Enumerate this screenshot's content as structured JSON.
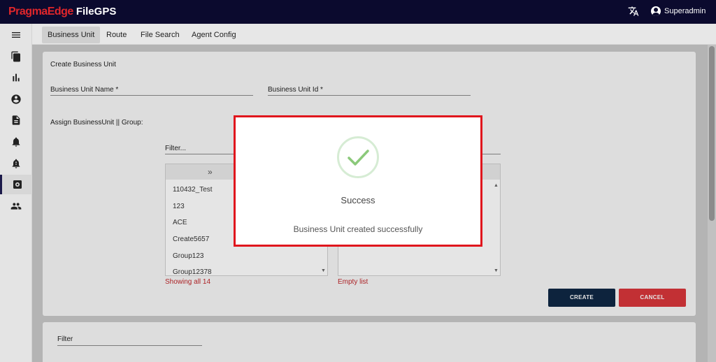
{
  "header": {
    "brand_name": "PragmaEdge",
    "product_name": "FileGPS",
    "language_icon": "translate-icon",
    "user_icon": "account-circle-icon",
    "user_name": "Superadmin"
  },
  "sidebar": {
    "items": [
      {
        "name": "menu-icon"
      },
      {
        "name": "files-icon"
      },
      {
        "name": "bar-chart-icon"
      },
      {
        "name": "account-icon"
      },
      {
        "name": "document-icon"
      },
      {
        "name": "notification-icon"
      },
      {
        "name": "alert-icon"
      },
      {
        "name": "settings-icon",
        "active": true
      },
      {
        "name": "group-icon"
      }
    ]
  },
  "tabs": [
    {
      "label": "Business Unit",
      "active": true
    },
    {
      "label": "Route"
    },
    {
      "label": "File Search"
    },
    {
      "label": "Agent Config"
    }
  ],
  "form": {
    "title": "Create Business Unit",
    "unit_name_label": "Business Unit Name *",
    "unit_id_label": "Business Unit Id *",
    "assign_label": "Assign BusinessUnit || Group:",
    "filter_label": "Filter...",
    "move_all_symbol": "»",
    "available_list": [
      "110432_Test",
      "123",
      "ACE",
      "Create5657",
      "Group123",
      "Group12378"
    ],
    "available_status": "Showing all 14",
    "selected_status": "Empty list",
    "create_button": "CREATE",
    "cancel_button": "CANCEL"
  },
  "lower_card": {
    "filter_label": "Filter"
  },
  "modal": {
    "title": "Success",
    "message": "Business Unit created successfully",
    "icon": "check-icon"
  },
  "colors": {
    "topbar": "#0b0a2e",
    "brand_red": "#e0262b",
    "create_button": "#0f2744",
    "cancel_button": "#d9363a",
    "error_text": "#c0282c",
    "success_green": "#8bc97a"
  }
}
